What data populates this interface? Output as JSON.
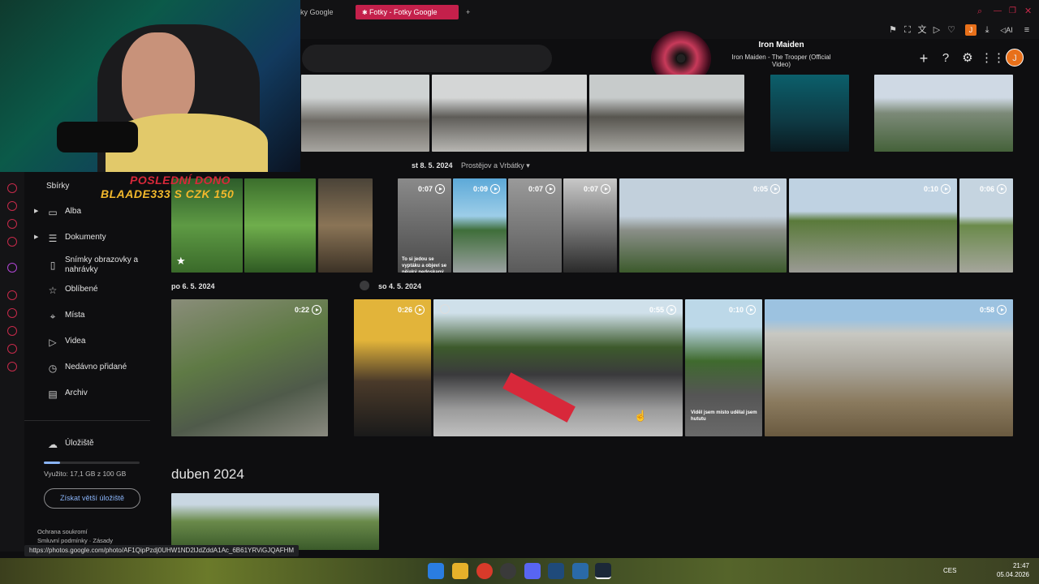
{
  "browser": {
    "tabs": [
      {
        "label": "ky Google",
        "active": false
      },
      {
        "label": "Fotky - Fotky Google",
        "active": true
      }
    ],
    "new_tab": "+",
    "status_url": "https://photos.google.com/photo/AF1QipPzdj0UHW1ND2lJdZddA1Ac_6B61YRViGJQAFHM",
    "toolbar_ai": "AI",
    "profile_initial": "J"
  },
  "music_widget": {
    "artist": "Iron Maiden",
    "track": "Iron Maiden - The Trooper (Official Video)"
  },
  "stream_overlay": {
    "donation_line1": "POSLEDNÍ DONO",
    "donation_line2": "BLAADE333 S CZK 150"
  },
  "app": {
    "avatar_initial": "J"
  },
  "nav": {
    "section_title": "Sbírky",
    "items": [
      {
        "label": "Alba",
        "icon": "album-icon",
        "expandable": true
      },
      {
        "label": "Dokumenty",
        "icon": "document-icon",
        "expandable": true
      },
      {
        "label": "Snímky obrazovky a nahrávky",
        "icon": "screenshot-icon",
        "expandable": false
      },
      {
        "label": "Oblíbené",
        "icon": "star-icon",
        "expandable": false
      },
      {
        "label": "Místa",
        "icon": "location-icon",
        "expandable": false
      },
      {
        "label": "Videa",
        "icon": "play-icon",
        "expandable": false
      },
      {
        "label": "Nedávno přidané",
        "icon": "recent-icon",
        "expandable": false
      },
      {
        "label": "Archiv",
        "icon": "archive-icon",
        "expandable": false
      }
    ],
    "storage_label": "Úložiště",
    "storage_usage": "Využito: 17,1 GB z 100 GB",
    "storage_fraction": 0.171,
    "storage_button": "Získat větší úložiště",
    "footer_links": [
      "Ochrana soukromí",
      "Smluvní podmínky",
      "Zásady"
    ]
  },
  "groups": {
    "g1_date": "st 8. 5. 2024",
    "g1_place": "Prostějov a Vrbátky",
    "g2_date": "po 6. 5. 2024",
    "g3_date": "so 4. 5. 2024",
    "month": "duben 2024"
  },
  "videos": {
    "r2": [
      "0:07",
      "0:09",
      "0:07",
      "0:07",
      "0:05",
      "0:10",
      "0:06"
    ],
    "r3": [
      "0:22",
      "0:26",
      "0:55",
      "0:10",
      "0:58"
    ],
    "caption_a": "To si jedou se vyptáku a objeví se nějaký nedoskaný hovado",
    "caption_b": "Viděl jsem místo udělal jsem hututu"
  },
  "clock": {
    "time": "21:47",
    "date": "05.04.2026",
    "lang": "CES"
  },
  "colors": {
    "accent": "#c4204b",
    "avatar": "#e8701a",
    "bg": "#0e0e10"
  }
}
